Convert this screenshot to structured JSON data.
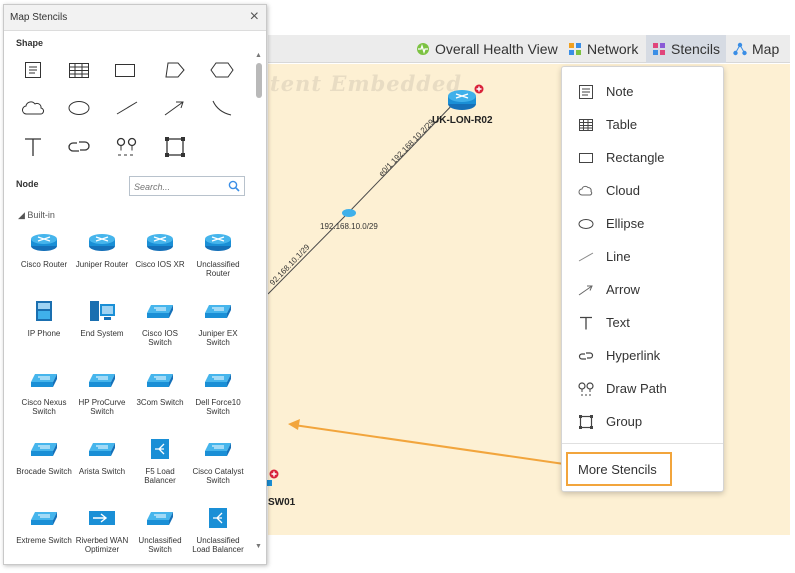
{
  "toolbar": {
    "items": [
      {
        "label": "Overall Health View",
        "icon": "health-icon"
      },
      {
        "label": "Network",
        "icon": "network-icon"
      },
      {
        "label": "Stencils",
        "icon": "stencils-icon",
        "active": true
      },
      {
        "label": "Map",
        "icon": "map-icon"
      }
    ]
  },
  "canvas": {
    "watermark": "tent Embedded",
    "device_top": "UK-LON-R02",
    "device_bottom": "SW01",
    "hub_label": "192.168.10.0/29",
    "link_upper": "e0/1 192.168.10.2/29",
    "link_lower": "92.168.10.1/29"
  },
  "panel": {
    "title": "Map Stencils",
    "close": "×",
    "shape_section": "Shape",
    "node_section": "Node",
    "search_placeholder": "Search...",
    "builtin": "◢ Built-in",
    "shapes": [
      "note",
      "table",
      "rectangle",
      "polygon",
      "hexagon",
      "cloud",
      "ellipse",
      "line",
      "arrow",
      "curve",
      "text",
      "hyperlink",
      "draw-path",
      "group"
    ],
    "nodes": [
      {
        "label": "Cisco Router",
        "icon": "router-icon"
      },
      {
        "label": "Juniper Router",
        "icon": "router-icon"
      },
      {
        "label": "Cisco IOS XR",
        "icon": "router-icon"
      },
      {
        "label": "Unclassified Router",
        "icon": "router-icon"
      },
      {
        "label": "IP Phone",
        "icon": "ip-phone-icon"
      },
      {
        "label": "End System",
        "icon": "end-system-icon"
      },
      {
        "label": "Cisco IOS Switch",
        "icon": "switch-icon"
      },
      {
        "label": "Juniper EX Switch",
        "icon": "switch-icon"
      },
      {
        "label": "Cisco Nexus Switch",
        "icon": "switch-icon"
      },
      {
        "label": "HP ProCurve Switch",
        "icon": "switch-icon"
      },
      {
        "label": "3Com Switch",
        "icon": "switch-icon"
      },
      {
        "label": "Dell Force10 Switch",
        "icon": "switch-icon"
      },
      {
        "label": "Brocade Switch",
        "icon": "switch-icon"
      },
      {
        "label": "Arista Switch",
        "icon": "switch-icon"
      },
      {
        "label": "F5 Load Balancer",
        "icon": "load-balancer-icon"
      },
      {
        "label": "Cisco Catalyst Switch",
        "icon": "switch-icon"
      },
      {
        "label": "Extreme Switch",
        "icon": "switch-icon"
      },
      {
        "label": "Riverbed WAN Optimizer",
        "icon": "wan-optimizer-icon"
      },
      {
        "label": "Unclassified Switch",
        "icon": "switch-icon"
      },
      {
        "label": "Unclassified Load Balancer",
        "icon": "load-balancer-icon"
      }
    ]
  },
  "menu": {
    "items": [
      {
        "label": "Note",
        "icon": "note-icon"
      },
      {
        "label": "Table",
        "icon": "table-icon"
      },
      {
        "label": "Rectangle",
        "icon": "rectangle-icon"
      },
      {
        "label": "Cloud",
        "icon": "cloud-icon"
      },
      {
        "label": "Ellipse",
        "icon": "ellipse-icon"
      },
      {
        "label": "Line",
        "icon": "line-icon"
      },
      {
        "label": "Arrow",
        "icon": "arrow-icon"
      },
      {
        "label": "Text",
        "icon": "text-icon"
      },
      {
        "label": "Hyperlink",
        "icon": "hyperlink-icon"
      },
      {
        "label": "Draw Path",
        "icon": "draw-path-icon"
      },
      {
        "label": "Group",
        "icon": "group-icon"
      }
    ],
    "more": "More Stencils"
  },
  "colors": {
    "canvas_bg": "#fdf0d3",
    "callout": "#f2a53c",
    "device_blue": "#1a8fd6"
  }
}
